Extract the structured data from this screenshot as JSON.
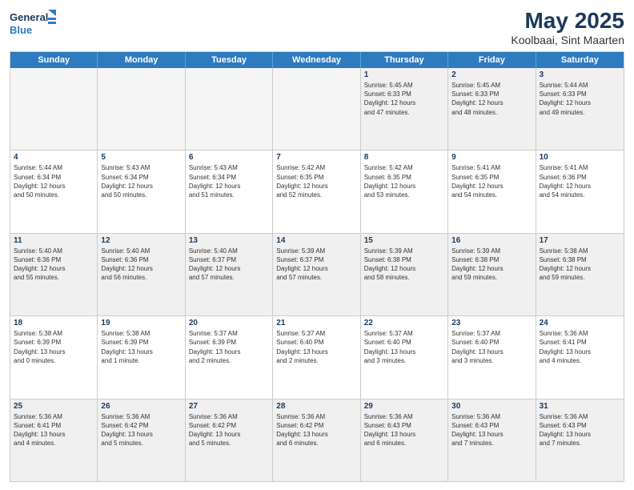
{
  "header": {
    "logo_line1": "General",
    "logo_line2": "Blue",
    "title": "May 2025",
    "subtitle": "Koolbaai, Sint Maarten"
  },
  "days_of_week": [
    "Sunday",
    "Monday",
    "Tuesday",
    "Wednesday",
    "Thursday",
    "Friday",
    "Saturday"
  ],
  "weeks": [
    [
      {
        "day": "",
        "empty": true
      },
      {
        "day": "",
        "empty": true
      },
      {
        "day": "",
        "empty": true
      },
      {
        "day": "",
        "empty": true
      },
      {
        "day": "1",
        "lines": [
          "Sunrise: 5:45 AM",
          "Sunset: 6:33 PM",
          "Daylight: 12 hours",
          "and 47 minutes."
        ]
      },
      {
        "day": "2",
        "lines": [
          "Sunrise: 5:45 AM",
          "Sunset: 6:33 PM",
          "Daylight: 12 hours",
          "and 48 minutes."
        ]
      },
      {
        "day": "3",
        "lines": [
          "Sunrise: 5:44 AM",
          "Sunset: 6:33 PM",
          "Daylight: 12 hours",
          "and 49 minutes."
        ]
      }
    ],
    [
      {
        "day": "4",
        "lines": [
          "Sunrise: 5:44 AM",
          "Sunset: 6:34 PM",
          "Daylight: 12 hours",
          "and 50 minutes."
        ]
      },
      {
        "day": "5",
        "lines": [
          "Sunrise: 5:43 AM",
          "Sunset: 6:34 PM",
          "Daylight: 12 hours",
          "and 50 minutes."
        ]
      },
      {
        "day": "6",
        "lines": [
          "Sunrise: 5:43 AM",
          "Sunset: 6:34 PM",
          "Daylight: 12 hours",
          "and 51 minutes."
        ]
      },
      {
        "day": "7",
        "lines": [
          "Sunrise: 5:42 AM",
          "Sunset: 6:35 PM",
          "Daylight: 12 hours",
          "and 52 minutes."
        ]
      },
      {
        "day": "8",
        "lines": [
          "Sunrise: 5:42 AM",
          "Sunset: 6:35 PM",
          "Daylight: 12 hours",
          "and 53 minutes."
        ]
      },
      {
        "day": "9",
        "lines": [
          "Sunrise: 5:41 AM",
          "Sunset: 6:35 PM",
          "Daylight: 12 hours",
          "and 54 minutes."
        ]
      },
      {
        "day": "10",
        "lines": [
          "Sunrise: 5:41 AM",
          "Sunset: 6:36 PM",
          "Daylight: 12 hours",
          "and 54 minutes."
        ]
      }
    ],
    [
      {
        "day": "11",
        "lines": [
          "Sunrise: 5:40 AM",
          "Sunset: 6:36 PM",
          "Daylight: 12 hours",
          "and 55 minutes."
        ]
      },
      {
        "day": "12",
        "lines": [
          "Sunrise: 5:40 AM",
          "Sunset: 6:36 PM",
          "Daylight: 12 hours",
          "and 56 minutes."
        ]
      },
      {
        "day": "13",
        "lines": [
          "Sunrise: 5:40 AM",
          "Sunset: 6:37 PM",
          "Daylight: 12 hours",
          "and 57 minutes."
        ]
      },
      {
        "day": "14",
        "lines": [
          "Sunrise: 5:39 AM",
          "Sunset: 6:37 PM",
          "Daylight: 12 hours",
          "and 57 minutes."
        ]
      },
      {
        "day": "15",
        "lines": [
          "Sunrise: 5:39 AM",
          "Sunset: 6:38 PM",
          "Daylight: 12 hours",
          "and 58 minutes."
        ]
      },
      {
        "day": "16",
        "lines": [
          "Sunrise: 5:39 AM",
          "Sunset: 6:38 PM",
          "Daylight: 12 hours",
          "and 59 minutes."
        ]
      },
      {
        "day": "17",
        "lines": [
          "Sunrise: 5:38 AM",
          "Sunset: 6:38 PM",
          "Daylight: 12 hours",
          "and 59 minutes."
        ]
      }
    ],
    [
      {
        "day": "18",
        "lines": [
          "Sunrise: 5:38 AM",
          "Sunset: 6:39 PM",
          "Daylight: 13 hours",
          "and 0 minutes."
        ]
      },
      {
        "day": "19",
        "lines": [
          "Sunrise: 5:38 AM",
          "Sunset: 6:39 PM",
          "Daylight: 13 hours",
          "and 1 minute."
        ]
      },
      {
        "day": "20",
        "lines": [
          "Sunrise: 5:37 AM",
          "Sunset: 6:39 PM",
          "Daylight: 13 hours",
          "and 2 minutes."
        ]
      },
      {
        "day": "21",
        "lines": [
          "Sunrise: 5:37 AM",
          "Sunset: 6:40 PM",
          "Daylight: 13 hours",
          "and 2 minutes."
        ]
      },
      {
        "day": "22",
        "lines": [
          "Sunrise: 5:37 AM",
          "Sunset: 6:40 PM",
          "Daylight: 13 hours",
          "and 3 minutes."
        ]
      },
      {
        "day": "23",
        "lines": [
          "Sunrise: 5:37 AM",
          "Sunset: 6:40 PM",
          "Daylight: 13 hours",
          "and 3 minutes."
        ]
      },
      {
        "day": "24",
        "lines": [
          "Sunrise: 5:36 AM",
          "Sunset: 6:41 PM",
          "Daylight: 13 hours",
          "and 4 minutes."
        ]
      }
    ],
    [
      {
        "day": "25",
        "lines": [
          "Sunrise: 5:36 AM",
          "Sunset: 6:41 PM",
          "Daylight: 13 hours",
          "and 4 minutes."
        ]
      },
      {
        "day": "26",
        "lines": [
          "Sunrise: 5:36 AM",
          "Sunset: 6:42 PM",
          "Daylight: 13 hours",
          "and 5 minutes."
        ]
      },
      {
        "day": "27",
        "lines": [
          "Sunrise: 5:36 AM",
          "Sunset: 6:42 PM",
          "Daylight: 13 hours",
          "and 5 minutes."
        ]
      },
      {
        "day": "28",
        "lines": [
          "Sunrise: 5:36 AM",
          "Sunset: 6:42 PM",
          "Daylight: 13 hours",
          "and 6 minutes."
        ]
      },
      {
        "day": "29",
        "lines": [
          "Sunrise: 5:36 AM",
          "Sunset: 6:43 PM",
          "Daylight: 13 hours",
          "and 6 minutes."
        ]
      },
      {
        "day": "30",
        "lines": [
          "Sunrise: 5:36 AM",
          "Sunset: 6:43 PM",
          "Daylight: 13 hours",
          "and 7 minutes."
        ]
      },
      {
        "day": "31",
        "lines": [
          "Sunrise: 5:36 AM",
          "Sunset: 6:43 PM",
          "Daylight: 13 hours",
          "and 7 minutes."
        ]
      }
    ]
  ]
}
